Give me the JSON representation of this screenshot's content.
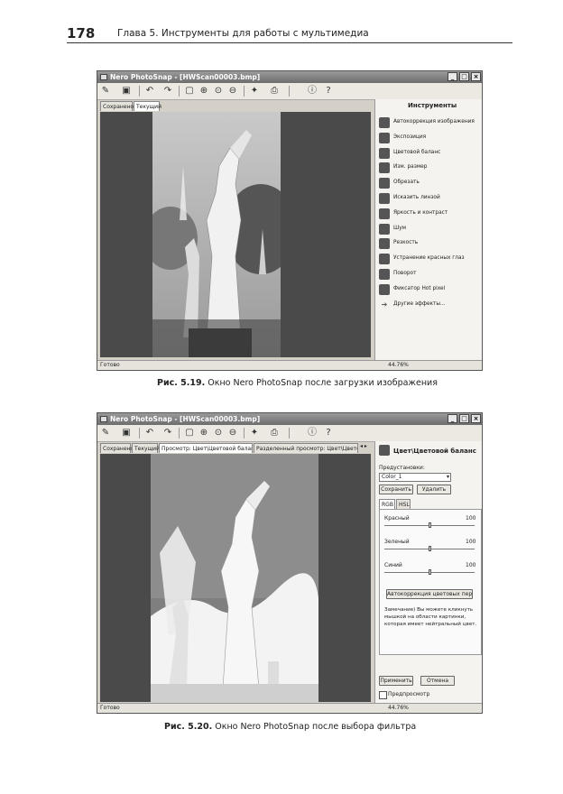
{
  "page": {
    "number": "178",
    "chapter_title": "Глава 5. Инструменты для работы с мультимедиа"
  },
  "figure1": {
    "window_title": "Nero PhotoSnap - [HWScan00003.bmp]",
    "tabs": [
      "Сохранено",
      "Текущий"
    ],
    "panel_title": "Инструменты",
    "tools": [
      {
        "label": "Автокоррекция изображения",
        "icon": "auto-correct-icon"
      },
      {
        "label": "Экспозиция",
        "icon": "exposure-icon"
      },
      {
        "label": "Цветовой баланс",
        "icon": "color-balance-icon"
      },
      {
        "label": "Изм. размер",
        "icon": "resize-icon"
      },
      {
        "label": "Обрезать",
        "icon": "crop-icon"
      },
      {
        "label": "Исказить линзой",
        "icon": "lens-distort-icon"
      },
      {
        "label": "Яркость и контраст",
        "icon": "brightness-contrast-icon"
      },
      {
        "label": "Шум",
        "icon": "noise-icon"
      },
      {
        "label": "Резкость",
        "icon": "sharpness-icon"
      },
      {
        "label": "Устранение красных глаз",
        "icon": "red-eye-icon"
      },
      {
        "label": "Поворот",
        "icon": "rotate-icon"
      },
      {
        "label": "Фиксатор Hot pixel",
        "icon": "hot-pixel-icon"
      },
      {
        "label": "Другие эффекты...",
        "icon": "arrow-right-icon"
      }
    ],
    "status_left": "Готово",
    "status_zoom": "44.76%",
    "caption_label": "Рис. 5.19.",
    "caption_text": " Окно Nero PhotoSnap после загрузки изображения"
  },
  "figure2": {
    "window_title": "Nero PhotoSnap - [HWScan00003.bmp]",
    "tabs": [
      "Сохранено",
      "Текущий",
      "Просмотр: Цвет\\Цветовой баланс",
      "Разделенный просмотр: Цвет\\Цветовой ба"
    ],
    "panel_title": "Цвет\\Цветовой баланс",
    "presets_label": "Предустановки:",
    "preset_value": "Color_1",
    "save_button": "Сохранить",
    "delete_button": "Удалить",
    "subtabs": [
      "RGB",
      "HSL"
    ],
    "sliders": [
      {
        "label": "Красный",
        "value": "100",
        "level": 0.5
      },
      {
        "label": "Зеленый",
        "value": "100",
        "level": 0.5
      },
      {
        "label": "Синий",
        "value": "100",
        "level": 0.5
      }
    ],
    "auto_button": "Автокоррекция цветовых переходов",
    "hint_text": [
      "Замечание) Вы можете кликнуть",
      "мышкой на области картинки,",
      "которая имеет нейтральный цвет."
    ],
    "apply_button": "Применить",
    "cancel_button": "Отмена",
    "preview_label": "Предпросмотр",
    "status_left": "Готово",
    "status_zoom": "44.76%",
    "caption_label": "Рис. 5.20.",
    "caption_text": " Окно Nero PhotoSnap после выбора фильтра"
  }
}
